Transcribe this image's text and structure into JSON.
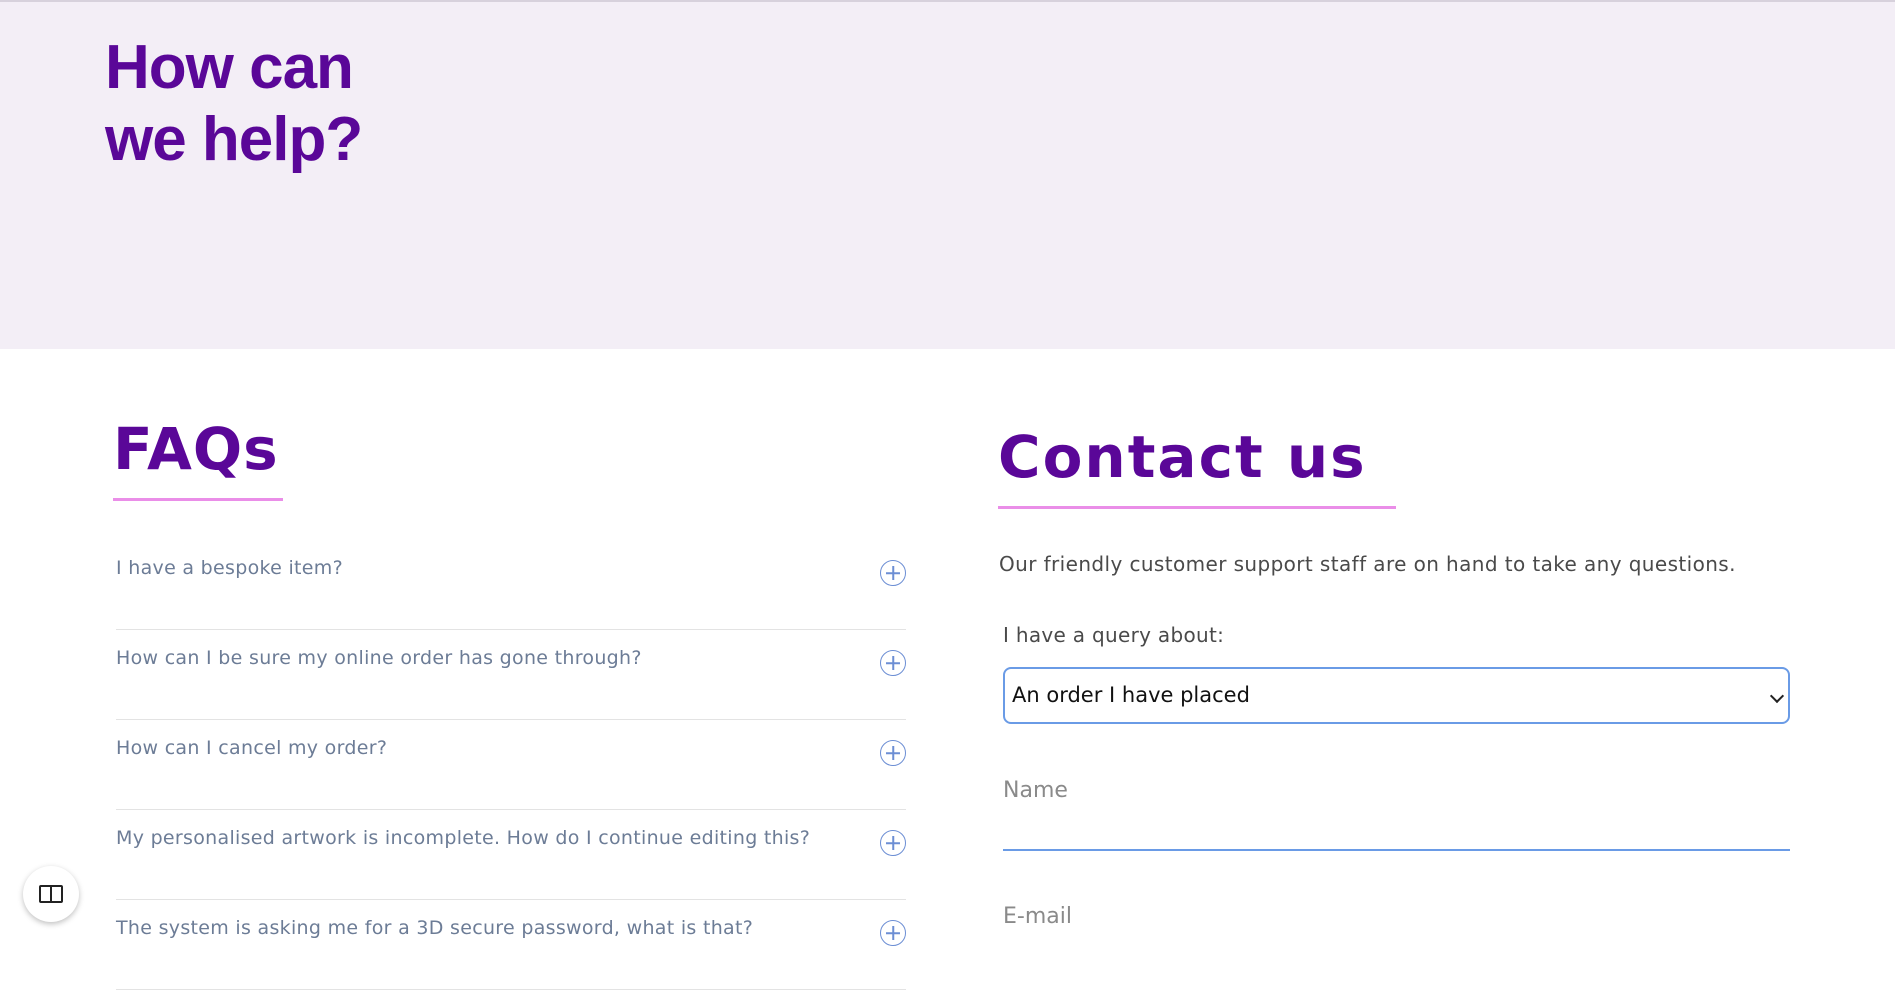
{
  "hero": {
    "title": "How can\nwe help?"
  },
  "faqs": {
    "title": "FAQs",
    "items": [
      {
        "question": "I have a bespoke item?"
      },
      {
        "question": "How can I be sure my online order has gone through?"
      },
      {
        "question": "How can I cancel my order?"
      },
      {
        "question": "My personalised artwork is incomplete. How do I continue editing this?"
      },
      {
        "question": "The system is asking me for a 3D secure password, what is that?"
      }
    ]
  },
  "contact": {
    "title": "Contact us",
    "intro": "Our friendly customer support staff are on hand to take any questions.",
    "query_label": "I have a query about:",
    "query_selected": "An order I have placed",
    "name_placeholder": "Name",
    "email_placeholder": "E-mail"
  },
  "colors": {
    "brand_purple": "#5a0798",
    "accent_pink": "#ea8ee8",
    "hero_background": "#f3eef6",
    "focus_blue": "#6a9be6"
  },
  "icons": {
    "faq_expand": "plus-circle-icon",
    "select_arrow": "chevron-down-icon",
    "layout_toggle": "split-panel-icon"
  }
}
